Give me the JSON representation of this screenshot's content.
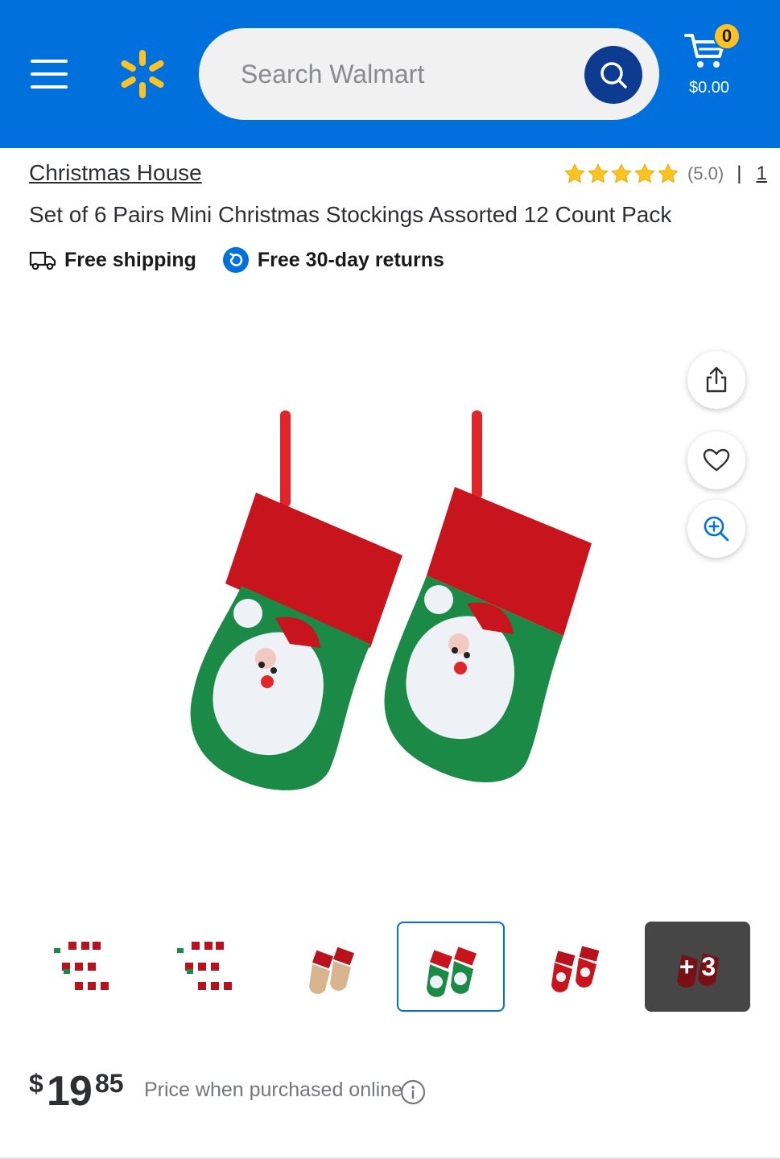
{
  "header": {
    "search_placeholder": "Search Walmart",
    "cart_count": "0",
    "cart_total": "$0.00",
    "colors": {
      "brand_blue": "#0071dc",
      "spark_yellow": "#ffc220",
      "search_button": "#0c3b8f"
    }
  },
  "product": {
    "brand": "Christmas House",
    "title": "Set of 6 Pairs Mini Christmas Stockings Assorted 12 Count Pack",
    "rating_value": 5.0,
    "rating_label": "(5.0)",
    "rating_separator": "|",
    "review_count": "1",
    "perks": [
      {
        "icon": "truck-icon",
        "label": "Free shipping"
      },
      {
        "icon": "return-icon",
        "label": "Free 30-day returns"
      }
    ]
  },
  "image_actions": [
    {
      "icon": "share-icon"
    },
    {
      "icon": "heart-icon"
    },
    {
      "icon": "zoom-in-icon"
    }
  ],
  "thumbnails": {
    "selected_index": 3,
    "more_label": "+ 3"
  },
  "price": {
    "currency": "$",
    "dollars": "19",
    "cents": "85",
    "note": "Price when purchased online"
  }
}
